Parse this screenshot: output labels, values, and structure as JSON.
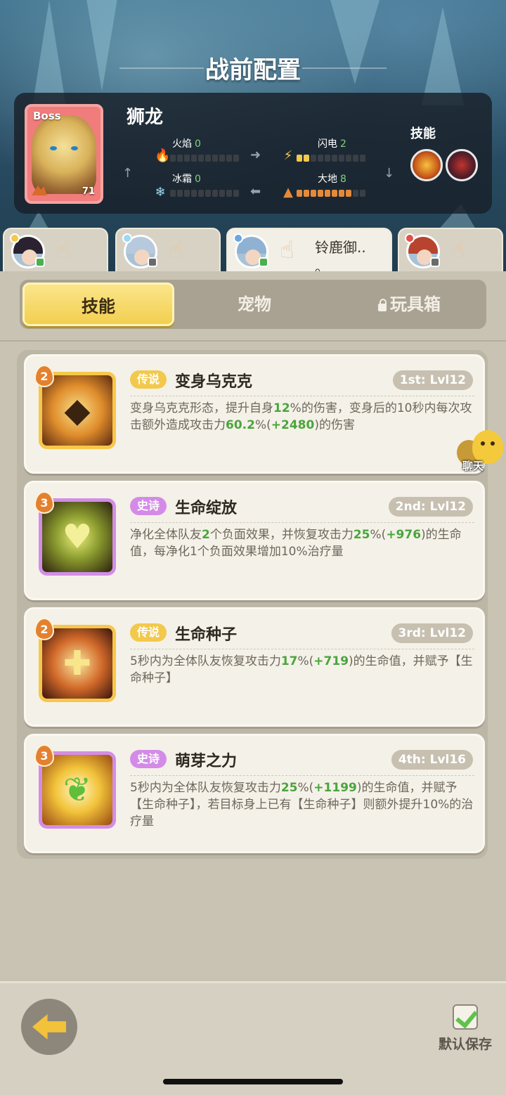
{
  "header": {
    "title": "战前配置"
  },
  "boss": {
    "tag": "Boss",
    "name": "狮龙",
    "level": "71",
    "skills_label": "技能",
    "stats": [
      {
        "key": "fire",
        "label": "火焰",
        "value": "0",
        "fill": 0,
        "icon": "fire-icon"
      },
      {
        "key": "lightning",
        "label": "闪电",
        "value": "2",
        "fill": 2,
        "icon": "lightning-icon"
      },
      {
        "key": "frost",
        "label": "冰霜",
        "value": "0",
        "fill": 0,
        "icon": "snowflake-icon"
      },
      {
        "key": "earth",
        "label": "大地",
        "value": "8",
        "fill": 8,
        "icon": "mountain-icon"
      }
    ]
  },
  "heroes": [
    {
      "name": "",
      "status": "online"
    },
    {
      "name": "",
      "status": "offline"
    },
    {
      "name": "铃鹿御..\n。",
      "status": "online",
      "active": true
    },
    {
      "name": "",
      "status": "offline"
    }
  ],
  "tabs": {
    "skills": "技能",
    "pets": "宠物",
    "toybox": "玩具箱"
  },
  "skills": [
    {
      "level": "2",
      "rarity": "传说",
      "rarity_type": "legend",
      "name": "变身乌克克",
      "slot": "1st: Lvl12",
      "desc_parts": [
        "变身乌克克形态，提升自身",
        "12",
        "%的伤害，变身后的10秒内每次攻击额外造成攻击力",
        "60.2",
        "%(",
        "+2480",
        ")的伤害"
      ]
    },
    {
      "level": "3",
      "rarity": "史诗",
      "rarity_type": "epic",
      "name": "生命绽放",
      "slot": "2nd: Lvl12",
      "desc_parts": [
        "净化全体队友",
        "2",
        "个负面效果，并恢复攻击力",
        "25",
        "%(",
        "+976",
        ")的生命值，每净化1个负面效果增加10%治疗量"
      ]
    },
    {
      "level": "2",
      "rarity": "传说",
      "rarity_type": "legend",
      "name": "生命种子",
      "slot": "3rd: Lvl12",
      "desc_parts": [
        "5秒内为全体队友恢复攻击力",
        "17",
        "%(",
        "+719",
        ")的生命值，并赋予【生命种子】"
      ]
    },
    {
      "level": "3",
      "rarity": "史诗",
      "rarity_type": "epic",
      "name": "萌芽之力",
      "slot": "4th: Lvl16",
      "desc_parts": [
        "5秒内为全体队友恢复攻击力",
        "25",
        "%(",
        "+1199",
        ")的生命值，并赋予【生命种子】，若目标身上已有【生命种子】则额外提升10%的治疗量"
      ]
    }
  ],
  "chat": {
    "label": "聊天"
  },
  "footer": {
    "save_label": "默认保存"
  },
  "colors": {
    "legend": "#f2c94c",
    "epic": "#d48be8",
    "highlight_green": "#4aa53d",
    "active_tab": "#f2cf4f"
  }
}
